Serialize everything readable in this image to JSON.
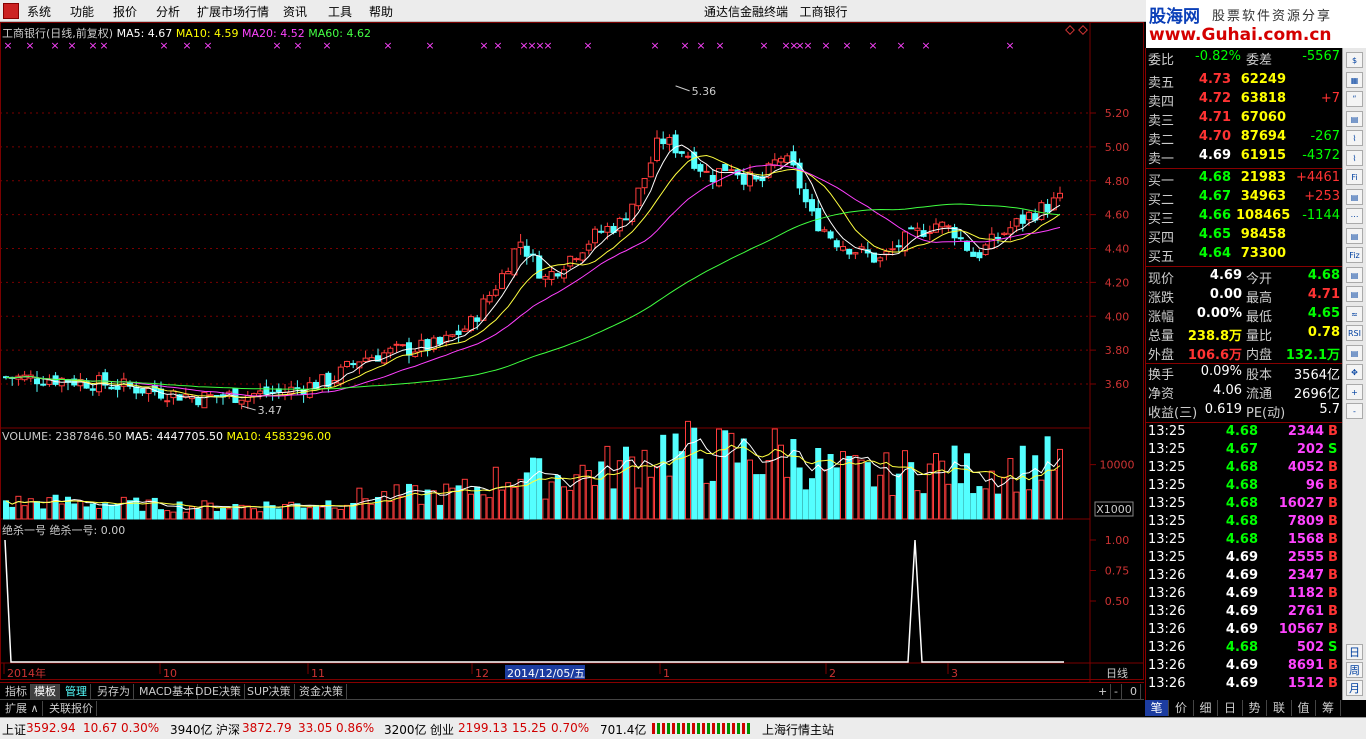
{
  "menu": {
    "items": [
      "系统",
      "功能",
      "报价",
      "分析",
      "扩展市场行情",
      "资讯",
      "工具",
      "帮助"
    ],
    "title": "通达信金融终端",
    "stock": "工商银行"
  },
  "brand": {
    "name": "股海网",
    "slogan": "股票软件资源分享",
    "url": "www.Guhai.com.cn"
  },
  "main_header": {
    "name": "工商银行(日线,前复权)",
    "ma5": "MA5: 4.67",
    "ma10": "MA10: 4.59",
    "ma20": "MA20: 4.52",
    "ma60": "MA60: 4.62"
  },
  "price_axis": [
    "5.20",
    "5.00",
    "4.80",
    "4.60",
    "4.40",
    "4.20",
    "4.00",
    "3.80",
    "3.60"
  ],
  "annotations": {
    "high": "5.36",
    "low": "3.47"
  },
  "volume_header": {
    "label": "VOLUME: 2387846.50",
    "ma5": "MA5: 4447705.50",
    "ma10": "MA10: 4583296.00"
  },
  "volume_axis": {
    "tick": "10000",
    "unit": "X1000"
  },
  "indicator_header": {
    "label": "绝杀一号",
    "value": "绝杀一号: 0.00"
  },
  "indicator_axis": [
    "1.00",
    "0.75",
    "0.50"
  ],
  "date_axis": {
    "labels": [
      "2014年",
      "10",
      "11",
      "12",
      "1",
      "2",
      "3"
    ],
    "cursor": "2014/12/05/五",
    "period": "日线"
  },
  "colors": {
    "up": "#ff3c3c",
    "down": "#54ffff",
    "ma5": "#ffffff",
    "ma10": "#ffff40",
    "ma20": "#ff40ff",
    "ma60": "#40ff40",
    "grid": "#7a0000"
  },
  "chart_data": {
    "type": "candlestick",
    "series_names": [
      "MA5",
      "MA10",
      "MA20",
      "MA60"
    ],
    "y_range": [
      3.45,
      5.4
    ],
    "price_labels": [
      "5.20",
      "5.00",
      "4.80",
      "4.60",
      "4.40",
      "4.20",
      "4.00",
      "3.80",
      "3.60"
    ],
    "high": 5.36,
    "low": 3.47,
    "indicator_range": [
      0,
      1
    ]
  },
  "quote": {
    "header": {
      "label": "委比",
      "value": "-0.82%",
      "label2": "委差",
      "value2": "-5567"
    },
    "asks": [
      {
        "label": "卖五",
        "price": "4.73",
        "vol": "62249",
        "chg": ""
      },
      {
        "label": "卖四",
        "price": "4.72",
        "vol": "63818",
        "chg": "+7"
      },
      {
        "label": "卖三",
        "price": "4.71",
        "vol": "67060",
        "chg": ""
      },
      {
        "label": "卖二",
        "price": "4.70",
        "vol": "87694",
        "chg": "-267"
      },
      {
        "label": "卖一",
        "price": "4.69",
        "vol": "61915",
        "chg": "-4372"
      }
    ],
    "bids": [
      {
        "label": "买一",
        "price": "4.68",
        "vol": "21983",
        "chg": "+4461"
      },
      {
        "label": "买二",
        "price": "4.67",
        "vol": "34963",
        "chg": "+253"
      },
      {
        "label": "买三",
        "price": "4.66",
        "vol": "108465",
        "chg": "-1144"
      },
      {
        "label": "买四",
        "price": "4.65",
        "vol": "98458",
        "chg": ""
      },
      {
        "label": "买五",
        "price": "4.64",
        "vol": "73300",
        "chg": ""
      }
    ],
    "stats": [
      {
        "l1": "现价",
        "v1": "4.69",
        "l2": "今开",
        "v2": "4.68"
      },
      {
        "l1": "涨跌",
        "v1": "0.00",
        "l2": "最高",
        "v2": "4.71"
      },
      {
        "l1": "涨幅",
        "v1": "0.00%",
        "l2": "最低",
        "v2": "4.65"
      },
      {
        "l1": "总量",
        "v1": "238.8万",
        "l2": "量比",
        "v2": "0.78"
      },
      {
        "l1": "外盘",
        "v1": "106.6万",
        "l2": "内盘",
        "v2": "132.1万"
      }
    ],
    "stats2": [
      {
        "l1": "换手",
        "v1": "0.09%",
        "l2": "股本",
        "v2": "3564亿"
      },
      {
        "l1": "净资",
        "v1": "4.06",
        "l2": "流通",
        "v2": "2696亿"
      },
      {
        "l1": "收益(三)",
        "v1": "0.619",
        "l2": "PE(动)",
        "v2": "5.7"
      }
    ],
    "ticks": [
      {
        "t": "13:25",
        "p": "4.68",
        "v": "2344",
        "s": "B"
      },
      {
        "t": "13:25",
        "p": "4.67",
        "v": "202",
        "s": "S"
      },
      {
        "t": "13:25",
        "p": "4.68",
        "v": "4052",
        "s": "B"
      },
      {
        "t": "13:25",
        "p": "4.68",
        "v": "96",
        "s": "B"
      },
      {
        "t": "13:25",
        "p": "4.68",
        "v": "16027",
        "s": "B"
      },
      {
        "t": "13:25",
        "p": "4.68",
        "v": "7809",
        "s": "B"
      },
      {
        "t": "13:25",
        "p": "4.68",
        "v": "1568",
        "s": "B"
      },
      {
        "t": "13:25",
        "p": "4.69",
        "v": "2555",
        "s": "B"
      },
      {
        "t": "13:26",
        "p": "4.69",
        "v": "2347",
        "s": "B"
      },
      {
        "t": "13:26",
        "p": "4.69",
        "v": "1182",
        "s": "B"
      },
      {
        "t": "13:26",
        "p": "4.69",
        "v": "2761",
        "s": "B"
      },
      {
        "t": "13:26",
        "p": "4.69",
        "v": "10567",
        "s": "B"
      },
      {
        "t": "13:26",
        "p": "4.68",
        "v": "502",
        "s": "S"
      },
      {
        "t": "13:26",
        "p": "4.69",
        "v": "8691",
        "s": "B"
      },
      {
        "t": "13:26",
        "p": "4.69",
        "v": "1512",
        "s": "B"
      }
    ]
  },
  "sidebar": {
    "icons": [
      "$",
      "▦",
      "ʺ",
      "▤",
      "⌇",
      "⌇",
      "Fi",
      "▤",
      "⋯",
      "▤",
      "Fiz",
      "▤",
      "▤",
      "≈",
      "RSI",
      "▤",
      "✥",
      "+",
      "-"
    ],
    "cjk": [
      "日",
      "周",
      "月"
    ]
  },
  "bottom_tabs": [
    "指标",
    "模板",
    "管理",
    "另存为",
    "MACD基本",
    "DDE决策",
    "SUP决策",
    "资金决策"
  ],
  "bottom_tabs2": [
    "扩展 ∧",
    "关联报价"
  ],
  "zoom": [
    "+",
    "-",
    "0"
  ],
  "right_tabs": [
    "笔",
    "价",
    "细",
    "日",
    "势",
    "联",
    "值",
    "筹"
  ],
  "status": {
    "sh_label": "上证",
    "sh_val": "3592.94",
    "sh_chg": "10.67",
    "sh_pct": "0.30%",
    "sh_amt": "3940亿",
    "sz_label": "沪深",
    "sz_val": "3872.79",
    "sz_chg": "33.05",
    "sz_pct": "0.86%",
    "sz_amt": "3200亿",
    "cy_label": "创业",
    "cy_val": "2199.13",
    "cy_chg": "15.25",
    "cy_pct": "0.70%",
    "cy_amt": "701.4亿",
    "server": "上海行情主站"
  }
}
